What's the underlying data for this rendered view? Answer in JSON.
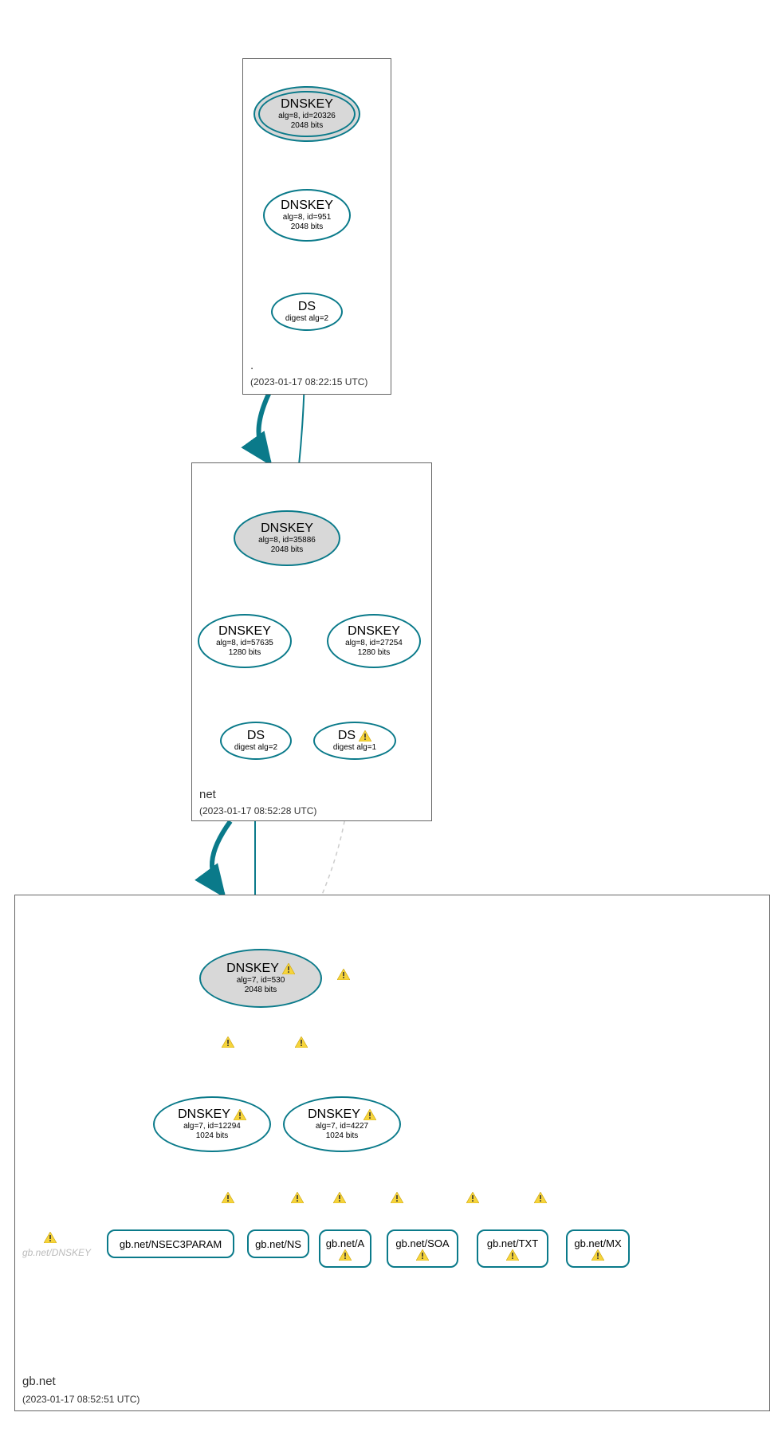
{
  "colors": {
    "teal": "#0a7a8a",
    "gray_fill": "#d8d8d8"
  },
  "zones": {
    "root": {
      "label": ".",
      "timestamp": "(2023-01-17 08:22:15 UTC)"
    },
    "net": {
      "label": "net",
      "timestamp": "(2023-01-17 08:52:28 UTC)"
    },
    "gb": {
      "label": "gb.net",
      "timestamp": "(2023-01-17 08:52:51 UTC)"
    }
  },
  "nodes": {
    "root_ksk": {
      "title": "DNSKEY",
      "sub1": "alg=8, id=20326",
      "sub2": "2048 bits",
      "warn": false
    },
    "root_zsk": {
      "title": "DNSKEY",
      "sub1": "alg=8, id=951",
      "sub2": "2048 bits",
      "warn": false
    },
    "root_ds": {
      "title": "DS",
      "sub1": "digest alg=2",
      "sub2": "",
      "warn": false
    },
    "net_ksk": {
      "title": "DNSKEY",
      "sub1": "alg=8, id=35886",
      "sub2": "2048 bits",
      "warn": false
    },
    "net_zsk1": {
      "title": "DNSKEY",
      "sub1": "alg=8, id=57635",
      "sub2": "1280 bits",
      "warn": false
    },
    "net_zsk2": {
      "title": "DNSKEY",
      "sub1": "alg=8, id=27254",
      "sub2": "1280 bits",
      "warn": false
    },
    "net_ds1": {
      "title": "DS",
      "sub1": "digest alg=2",
      "sub2": "",
      "warn": false
    },
    "net_ds2": {
      "title": "DS",
      "sub1": "digest alg=1",
      "sub2": "",
      "warn": true
    },
    "gb_ksk": {
      "title": "DNSKEY",
      "sub1": "alg=7, id=530",
      "sub2": "2048 bits",
      "warn": true
    },
    "gb_zsk1": {
      "title": "DNSKEY",
      "sub1": "alg=7, id=12294",
      "sub2": "1024 bits",
      "warn": true
    },
    "gb_zsk2": {
      "title": "DNSKEY",
      "sub1": "alg=7, id=4227",
      "sub2": "1024 bits",
      "warn": true
    },
    "leaf_nsec3": {
      "label": "gb.net/NSEC3PARAM",
      "warn": false
    },
    "leaf_ns": {
      "label": "gb.net/NS",
      "warn": false
    },
    "leaf_a": {
      "label": "gb.net/A",
      "warn": true
    },
    "leaf_soa": {
      "label": "gb.net/SOA",
      "warn": true
    },
    "leaf_txt": {
      "label": "gb.net/TXT",
      "warn": true
    },
    "leaf_mx": {
      "label": "gb.net/MX",
      "warn": true
    }
  },
  "gray_label": "gb.net/DNSKEY"
}
